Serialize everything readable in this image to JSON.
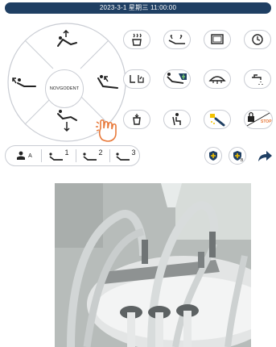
{
  "status_bar": {
    "datetime": "2023-3-1  星期三  11:00:00"
  },
  "dial": {
    "brand_label": "NOVGODENT"
  },
  "memory_bar": {
    "auto_label": "A",
    "positions": [
      {
        "number": "1"
      },
      {
        "number": "2"
      },
      {
        "number": "3"
      }
    ]
  },
  "badges": {
    "second_shield": "B"
  },
  "stop_label": "STOP",
  "colors": {
    "topbar": "#1f3f63",
    "accent_orange": "#e8793a",
    "accent_yellow": "#f3c200",
    "border": "#c9ccd3"
  }
}
